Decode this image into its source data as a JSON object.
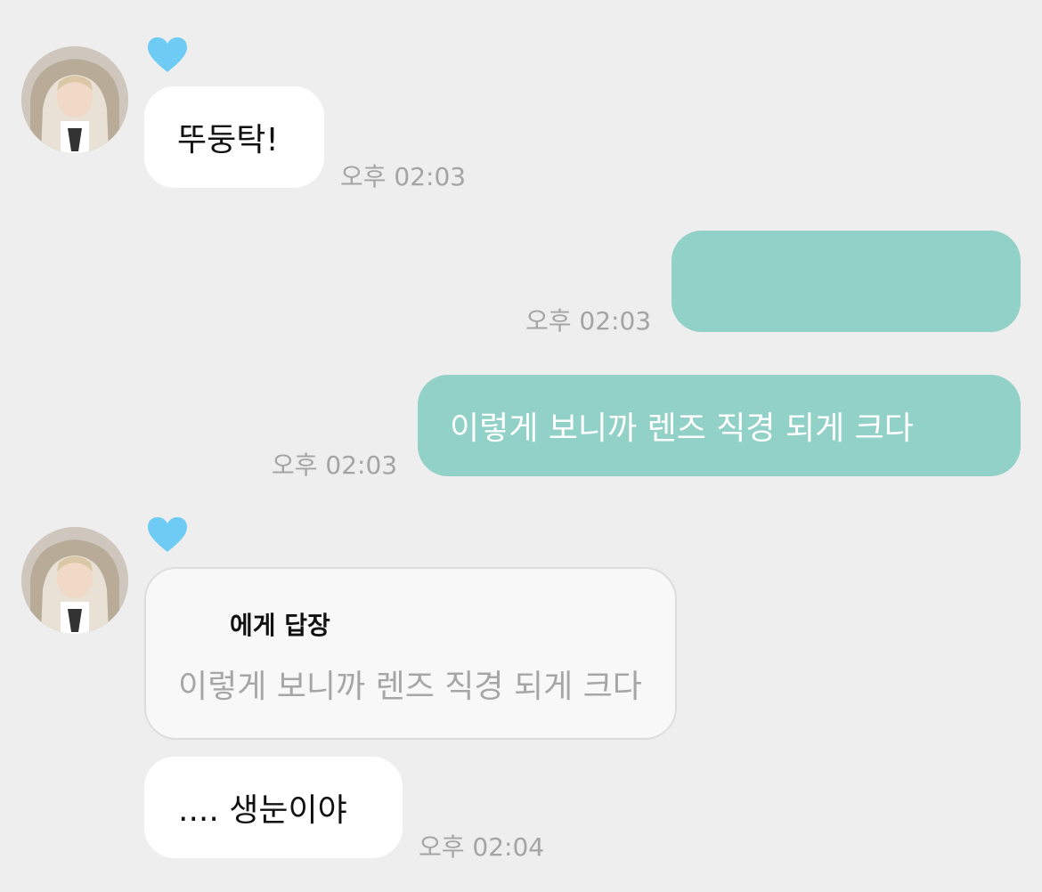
{
  "conversation": {
    "messages": [
      {
        "direction": "incoming",
        "text": "뚜둥탁!",
        "time": "오후 02:03"
      },
      {
        "direction": "outgoing",
        "text": "",
        "time": "오후 02:03"
      },
      {
        "direction": "outgoing",
        "text": "이렇게 보니까 렌즈 직경 되게 크다",
        "time": "오후 02:03"
      },
      {
        "direction": "incoming",
        "reply": {
          "label": "에게 답장",
          "quoted_text": "이렇게 보니까 렌즈 직경 되게 크다"
        }
      },
      {
        "direction": "incoming",
        "text": ".... 생눈이야",
        "time": "오후 02:04"
      }
    ]
  },
  "colors": {
    "background": "#eeeeee",
    "incoming_bubble": "#ffffff",
    "outgoing_bubble": "#92d1c8",
    "heart": "#6ecbf4",
    "timestamp": "#a4a4a4"
  },
  "icons": {
    "sender_badge": "blue-heart-icon",
    "sender_avatar": "avatar"
  }
}
